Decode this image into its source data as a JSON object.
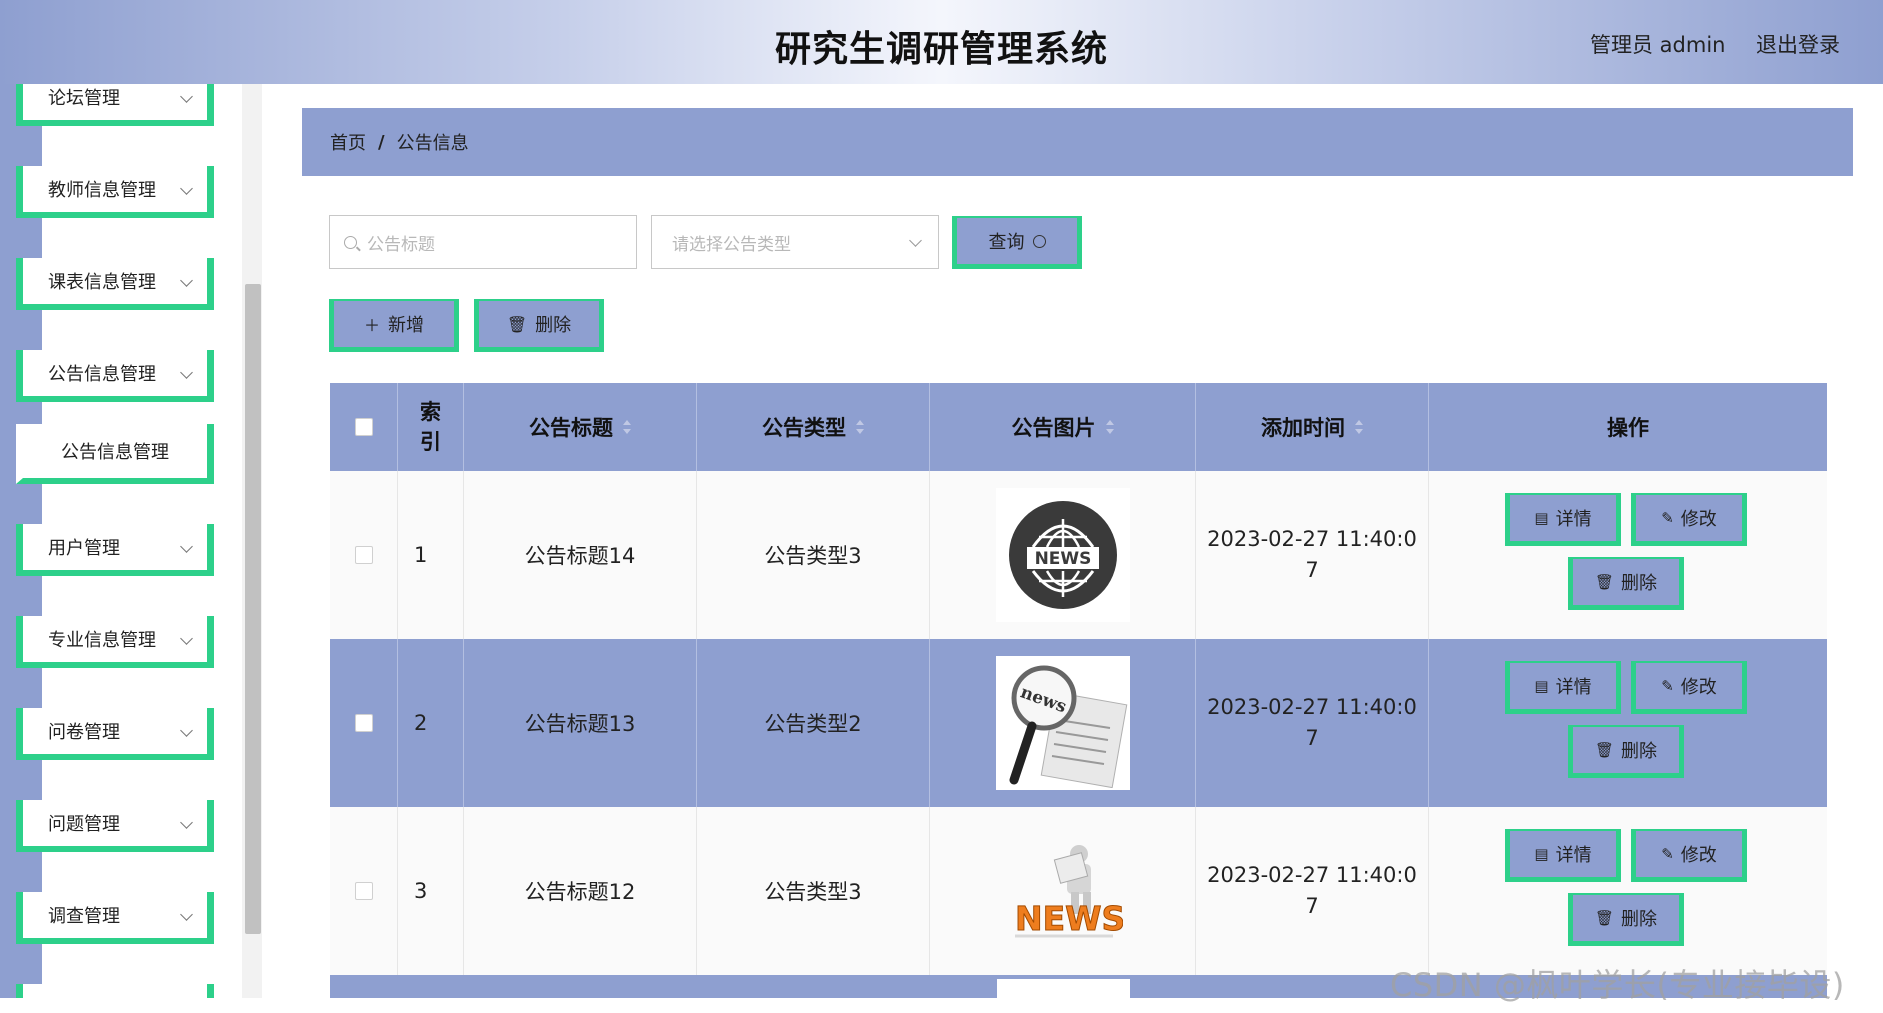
{
  "header": {
    "title": "研究生调研管理系统",
    "user": "管理员 admin",
    "logout": "退出登录"
  },
  "sidebar": {
    "items": [
      {
        "label": "论坛管理"
      },
      {
        "label": "教师信息管理"
      },
      {
        "label": "课表信息管理"
      },
      {
        "label": "公告信息管理"
      },
      {
        "label": "公告信息管理"
      },
      {
        "label": "用户管理"
      },
      {
        "label": "专业信息管理"
      },
      {
        "label": "问卷管理"
      },
      {
        "label": "问题管理"
      },
      {
        "label": "调查管理"
      }
    ]
  },
  "breadcrumb": {
    "home": "首页",
    "separator": "/",
    "current": "公告信息"
  },
  "search": {
    "title_placeholder": "公告标题",
    "type_placeholder": "请选择公告类型",
    "query_label": "查询"
  },
  "toolbar": {
    "add_label": "新增",
    "delete_label": "删除"
  },
  "table": {
    "headers": {
      "index": [
        "索",
        "引"
      ],
      "title": "公告标题",
      "type": "公告类型",
      "image": "公告图片",
      "time": "添加时间",
      "ops": "操作"
    },
    "rows": [
      {
        "index": "1",
        "title": "公告标题14",
        "type": "公告类型3",
        "time": [
          "2023-02-27 11:40:0",
          "7"
        ],
        "image_icon": "news-globe-icon"
      },
      {
        "index": "2",
        "title": "公告标题13",
        "type": "公告类型2",
        "time": [
          "2023-02-27 11:40:0",
          "7"
        ],
        "image_icon": "news-magnifier-icon"
      },
      {
        "index": "3",
        "title": "公告标题12",
        "type": "公告类型3",
        "time": [
          "2023-02-27 11:40:0",
          "7"
        ],
        "image_icon": "news-reader-icon"
      }
    ],
    "actions": {
      "detail": "详情",
      "edit": "修改",
      "delete": "删除"
    }
  },
  "watermark": "CSDN @枫叶学长(专业接毕设)",
  "colors": {
    "header_edge": "#8e9fd0",
    "panel": "#8e9fd0",
    "accent_border": "#2dd08a",
    "row_light": "#fafafa"
  }
}
